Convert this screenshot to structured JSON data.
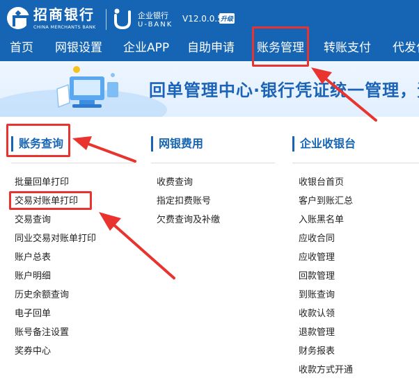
{
  "header": {
    "bank_name": "招商银行",
    "bank_english": "CHINA MERCHANTS BANK",
    "product_cn": "企业银行",
    "product_en": "U-BANK",
    "version": "V12.0.0.5",
    "upgrade_badge": "升级"
  },
  "nav": {
    "items": [
      "首页",
      "网银设置",
      "企业APP",
      "自助申请",
      "账务管理",
      "转账支付",
      "代发化"
    ]
  },
  "banner": {
    "text": "回单管理中心·银行凭证统一管理，资"
  },
  "columns": [
    {
      "title": "账务查询",
      "links": [
        "批量回单打印",
        "交易对账单打印",
        "交易查询",
        "同业交易对账单打印",
        "账户总表",
        "账户明细",
        "历史余额查询",
        "电子回单",
        "账号备注设置",
        "奖券中心"
      ]
    },
    {
      "title": "网银费用",
      "links": [
        "收费查询",
        "指定扣费账号",
        "欠费查询及补缴"
      ]
    },
    {
      "title": "企业收银台",
      "links": [
        "收银台首页",
        "客户到账汇总",
        "入账黑名单",
        "应收合同",
        "应收管理",
        "回款管理",
        "到账查询",
        "收款认领",
        "退款管理",
        "财务报表",
        "收款方式开通"
      ]
    }
  ],
  "colors": {
    "brand_blue": "#1665b4",
    "annotation_red": "#e8332e"
  }
}
